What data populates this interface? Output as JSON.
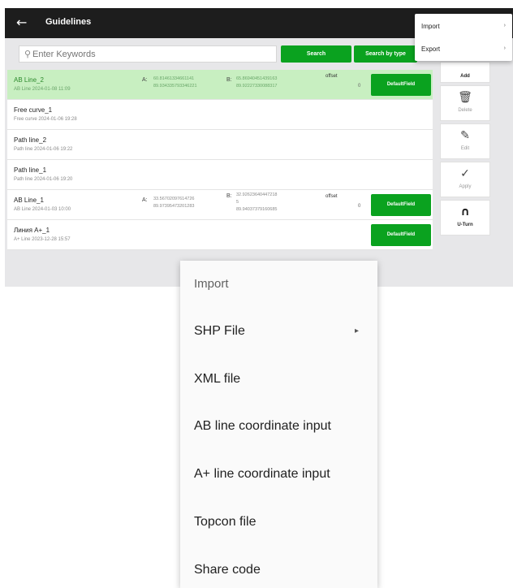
{
  "header": {
    "back_glyph": "←",
    "title": "Guidelines"
  },
  "search": {
    "placeholder": "Enter Keywords",
    "search_button": "Search",
    "search_by_type_button": "Search by type"
  },
  "lines": [
    {
      "name": "AB Line_2",
      "sub": "AB Line 2024-01-08 11:09",
      "selected": true,
      "a_label": "A:",
      "a_values": [
        "60.81461334661141",
        "89.934335793346221"
      ],
      "b_label": "B:",
      "b_values": [
        "65.86940451439163",
        "89.92227330088317"
      ],
      "offset_label": "offset",
      "offset_value": "0",
      "field_button": "DefaultField"
    },
    {
      "name": "Free curve_1",
      "sub": "Free curve 2024-01-06 19:28"
    },
    {
      "name": "Path line_2",
      "sub": "Path line 2024-01-06 19:22"
    },
    {
      "name": "Path line_1",
      "sub": "Path line 2024-01-06 19:20"
    },
    {
      "name": "AB Line_1",
      "sub": "AB Line 2024-01-03 10:00",
      "a_label": "A:",
      "a_values": [
        "33.56702097614726",
        "89.97395473201283"
      ],
      "b_label": "B:",
      "b_values": [
        "32.92623640447218",
        "5",
        "89.94037379160685"
      ],
      "offset_label": "offset",
      "offset_value": "0",
      "field_button": "DefaultField"
    },
    {
      "name": "Линия A+_1",
      "sub": "A+ Line 2023-12-28 15:57",
      "field_button": "DefaultField"
    }
  ],
  "tools": [
    {
      "label": "Add",
      "icon": "add-icon",
      "glyph": ""
    },
    {
      "label": "Delete",
      "icon": "trash-icon",
      "glyph": "🗑"
    },
    {
      "label": "Edit",
      "icon": "edit-icon",
      "glyph": "✎"
    },
    {
      "label": "Apply",
      "icon": "check-icon",
      "glyph": "✓"
    },
    {
      "label": "U-Turn",
      "icon": "u-turn-icon",
      "glyph": "∩"
    }
  ],
  "small_menu": [
    {
      "label": "Import",
      "arrow": "›"
    },
    {
      "label": "Export",
      "arrow": "›"
    }
  ],
  "import_menu": {
    "header": "Import",
    "items": [
      {
        "label": "SHP File",
        "arrow": "▸"
      },
      {
        "label": "XML file"
      },
      {
        "label": "AB line coordinate input"
      },
      {
        "label": "A+ line coordinate input"
      },
      {
        "label": "Topcon file"
      },
      {
        "label": "Share code"
      }
    ]
  },
  "colors": {
    "accent_green": "#0aa21f",
    "selected_row": "#c8efc1",
    "topbar": "#1d1d1d"
  }
}
